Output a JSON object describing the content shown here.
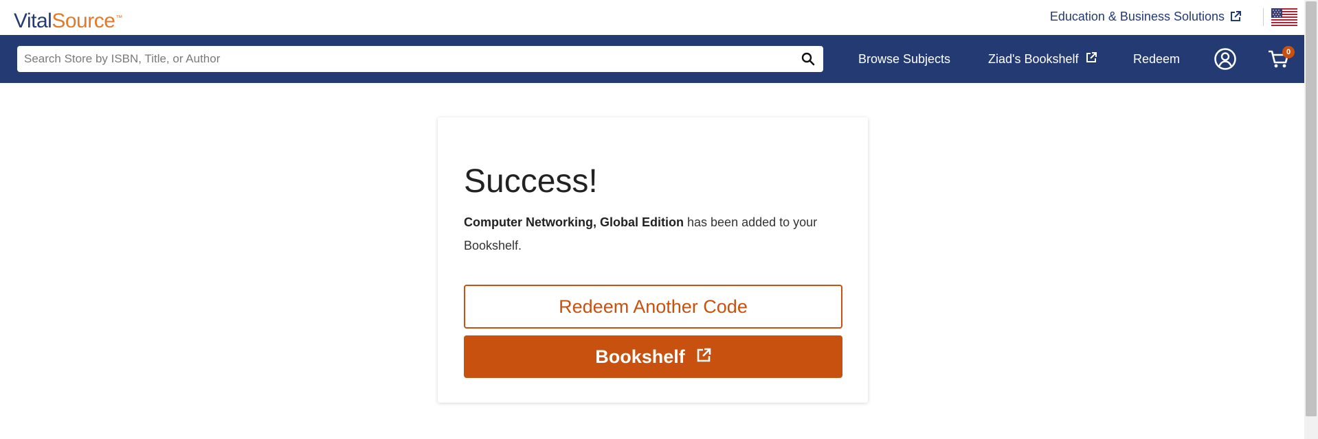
{
  "header": {
    "logo_primary": "Vital",
    "logo_secondary": "Source",
    "logo_tm": "™",
    "utility_link": "Education & Business Solutions",
    "locale_flag": "us-flag-icon"
  },
  "nav": {
    "search_placeholder": "Search Store by ISBN, Title, or Author",
    "browse_label": "Browse Subjects",
    "bookshelf_label": "Ziad's Bookshelf",
    "redeem_label": "Redeem",
    "cart_count": "0"
  },
  "card": {
    "title": "Success!",
    "book_title": "Computer Networking, Global Edition",
    "message_suffix": " has been added to your Bookshelf.",
    "redeem_another_label": "Redeem Another Code",
    "bookshelf_button_label": "Bookshelf"
  },
  "colors": {
    "navy": "#233a73",
    "accent_orange": "#c8510f",
    "logo_orange": "#e37a2b"
  }
}
